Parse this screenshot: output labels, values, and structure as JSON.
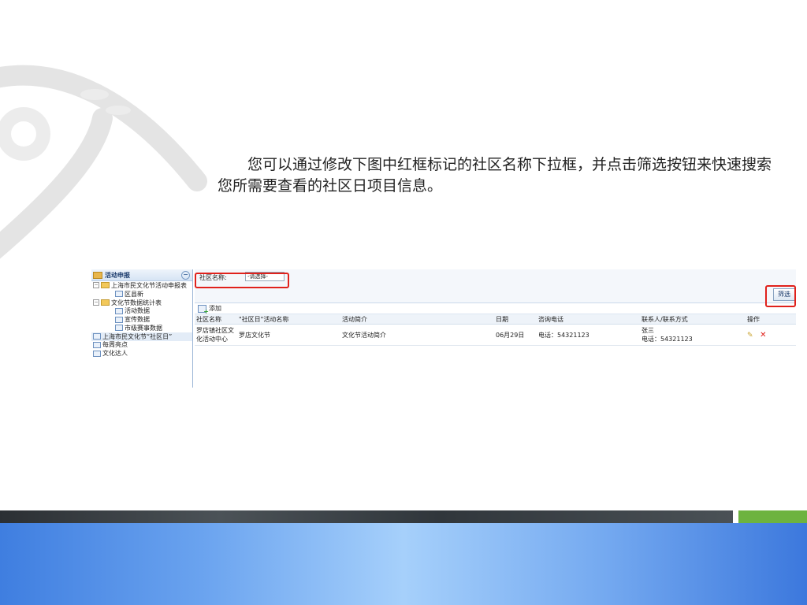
{
  "caption": "您可以通过修改下图中红框标记的社区名称下拉框，并点击筛选按钮来快速搜索您所需要查看的社区日项目信息。",
  "tree": {
    "title": "活动申报",
    "toggle": "−",
    "items": [
      {
        "label": "上海市民文化节活动申报表",
        "kind": "folder",
        "pm": "−"
      },
      {
        "label": "区县新",
        "kind": "doc"
      },
      {
        "label": "文化节数据统计表",
        "kind": "folder",
        "pm": "−"
      },
      {
        "label": "活动数据",
        "kind": "doc"
      },
      {
        "label": "宣传数据",
        "kind": "doc"
      },
      {
        "label": "市级赛事数据",
        "kind": "doc"
      },
      {
        "label": "上海市民文化节“社区日”",
        "kind": "doc"
      },
      {
        "label": "每周亮点",
        "kind": "doc"
      },
      {
        "label": "文化达人",
        "kind": "doc"
      }
    ]
  },
  "filter": {
    "label": "社区名称:",
    "select_value": "-请选择-",
    "button": "筛选"
  },
  "toolbar": {
    "add": "添加"
  },
  "table": {
    "headers": [
      "社区名称",
      "\"社区日\"活动名称",
      "活动简介",
      "日期",
      "咨询电话",
      "联系人/联系方式",
      "操作"
    ],
    "rows": [
      {
        "community": "罗店镇社区文化活动中心",
        "activity": "罗店文化节",
        "intro": "文化节活动简介",
        "date": "06月29日",
        "phone": "电话：54321123",
        "contact_name": "张三",
        "contact_phone": "电话：54321123"
      }
    ]
  },
  "colors": {
    "highlight": "#e0211b",
    "band_green": "#6db33f"
  }
}
